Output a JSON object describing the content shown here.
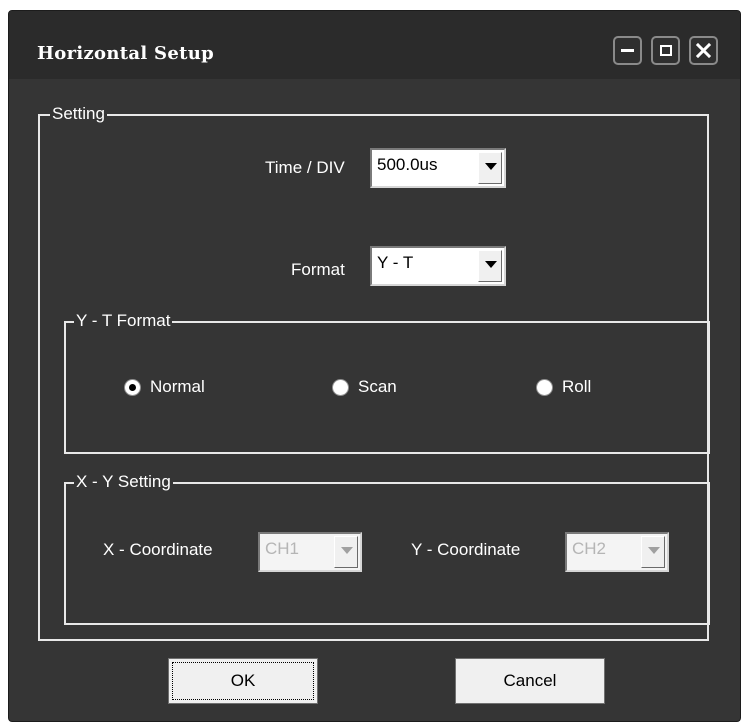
{
  "window": {
    "title": "Horizontal Setup",
    "controls": [
      "minimize-icon",
      "maximize-icon",
      "close-icon"
    ]
  },
  "setting": {
    "group_label": "Setting",
    "time_div_label": "Time / DIV",
    "time_div_value": "500.0us",
    "format_label": "Format",
    "format_value": "Y - T"
  },
  "yt_format": {
    "group_label": "Y - T Format",
    "options": [
      {
        "label": "Normal",
        "checked": true
      },
      {
        "label": "Scan",
        "checked": false
      },
      {
        "label": "Roll",
        "checked": false
      }
    ]
  },
  "xy_setting": {
    "group_label": "X - Y Setting",
    "x_label": "X - Coordinate",
    "x_value": "CH1",
    "y_label": "Y - Coordinate",
    "y_value": "CH2"
  },
  "buttons": {
    "ok": "OK",
    "cancel": "Cancel"
  }
}
